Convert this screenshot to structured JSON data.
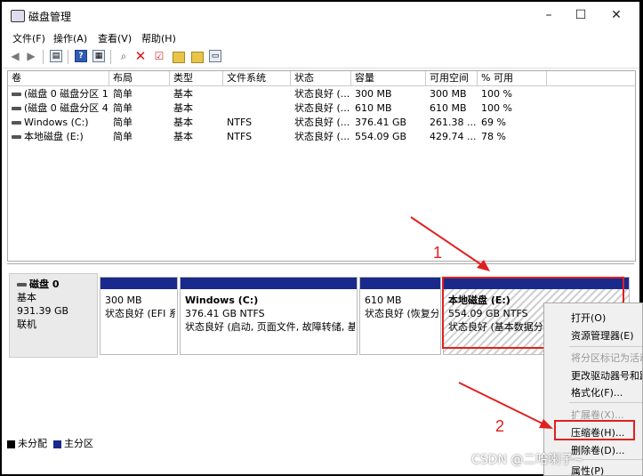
{
  "window": {
    "title": "磁盘管理"
  },
  "menu": [
    "文件(F)",
    "操作(A)",
    "查看(V)",
    "帮助(H)"
  ],
  "table": {
    "headers": [
      "卷",
      "布局",
      "类型",
      "文件系统",
      "状态",
      "容量",
      "可用空间",
      "% 可用"
    ],
    "rows": [
      [
        "(磁盘 0 磁盘分区 1)",
        "简单",
        "基本",
        "",
        "状态良好 (...",
        "300 MB",
        "300 MB",
        "100 %"
      ],
      [
        "(磁盘 0 磁盘分区 4)",
        "简单",
        "基本",
        "",
        "状态良好 (...",
        "610 MB",
        "610 MB",
        "100 %"
      ],
      [
        "Windows (C:)",
        "简单",
        "基本",
        "NTFS",
        "状态良好 (...",
        "376.41 GB",
        "261.38 ...",
        "69 %"
      ],
      [
        "本地磁盘 (E:)",
        "简单",
        "基本",
        "NTFS",
        "状态良好 (...",
        "554.09 GB",
        "429.74 ...",
        "78 %"
      ]
    ]
  },
  "disk": {
    "name": "磁盘 0",
    "type": "基本",
    "size": "931.39 GB",
    "status": "联机"
  },
  "partitions": [
    {
      "name": "",
      "size": "300 MB",
      "status": "状态良好 (EFI 系"
    },
    {
      "name": "Windows (C:)",
      "size": "376.41 GB NTFS",
      "status": "状态良好 (启动, 页面文件, 故障转储, 基本"
    },
    {
      "name": "",
      "size": "610 MB",
      "status": "状态良好 (恢复分"
    },
    {
      "name": "本地磁盘 (E:)",
      "size": "554.09 GB NTFS",
      "status": "状态良好 (基本数据分"
    }
  ],
  "legend": {
    "unallocated": "未分配",
    "primary": "主分区"
  },
  "context_menu": {
    "open": "打开(O)",
    "explorer": "资源管理器(E)",
    "mark_active": "将分区标记为活动",
    "change_letter": "更改驱动器号和路",
    "format": "格式化(F)...",
    "extend": "扩展卷(X)...",
    "shrink": "压缩卷(H)...",
    "delete": "删除卷(D)...",
    "properties": "属性(P)"
  },
  "annotations": {
    "one": "1",
    "two": "2"
  },
  "watermark": "CSDN @二哈喇子~",
  "colors": {
    "primary_partition": "#1a2a8c",
    "unallocated": "#000000",
    "highlight": "#e02020"
  }
}
